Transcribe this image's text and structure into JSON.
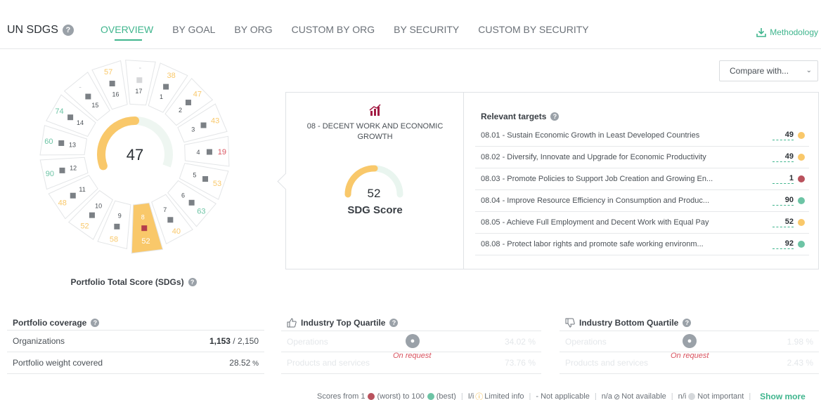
{
  "header": {
    "brand": "UN SDGS",
    "tabs": [
      "OVERVIEW",
      "BY GOAL",
      "BY ORG",
      "CUSTOM BY ORG",
      "BY SECURITY",
      "CUSTOM BY SECURITY"
    ],
    "active_tab": "OVERVIEW",
    "methodology": "Methodology"
  },
  "wheel": {
    "total_score": "47",
    "total_label": "Portfolio Total Score (SDGs)",
    "segments": [
      {
        "goal": "1",
        "score": "38"
      },
      {
        "goal": "2",
        "score": "47"
      },
      {
        "goal": "3",
        "score": "43"
      },
      {
        "goal": "4",
        "score": "19"
      },
      {
        "goal": "5",
        "score": "53"
      },
      {
        "goal": "6",
        "score": "63"
      },
      {
        "goal": "7",
        "score": "40"
      },
      {
        "goal": "8",
        "score": "52"
      },
      {
        "goal": "9",
        "score": "58"
      },
      {
        "goal": "10",
        "score": "52"
      },
      {
        "goal": "11",
        "score": "48"
      },
      {
        "goal": "12",
        "score": "90"
      },
      {
        "goal": "13",
        "score": "60"
      },
      {
        "goal": "14",
        "score": "74"
      },
      {
        "goal": "15",
        "score": "-"
      },
      {
        "goal": "16",
        "score": "57"
      },
      {
        "goal": "17",
        "score": "-"
      }
    ],
    "icon_labels": {
      "goal1": "MM"
    }
  },
  "compare": {
    "label": "Compare with..."
  },
  "goal_detail": {
    "title": "08 - DECENT WORK AND ECONOMIC GROWTH",
    "score": "52",
    "score_label": "SDG Score",
    "targets_heading": "Relevant targets",
    "targets": [
      {
        "label": "08.01 - Sustain Economic Growth in Least Developed Countries",
        "score": "49",
        "color": "#f9c86a"
      },
      {
        "label": "08.02 - Diversify, Innovate and Upgrade for Economic Productivity",
        "score": "49",
        "color": "#f9c86a"
      },
      {
        "label": "08.03 - Promote Policies to Support Job Creation and Growing En...",
        "score": "1",
        "color": "#b9525d"
      },
      {
        "label": "08.04 - Improve Resource Efficiency in Consumption and Produc...",
        "score": "90",
        "color": "#6dc4a5"
      },
      {
        "label": "08.05 - Achieve Full Employment and Decent Work with Equal Pay",
        "score": "52",
        "color": "#f9c86a"
      },
      {
        "label": "08.08 - Protect labor rights and promote safe working environm...",
        "score": "92",
        "color": "#6dc4a5"
      }
    ]
  },
  "coverage": {
    "title": "Portfolio coverage",
    "rows": [
      {
        "label": "Organizations",
        "value_bold": "1,153",
        "value_rest": " / 2,150"
      },
      {
        "label": "Portfolio weight covered",
        "value_bold": "28.52",
        "value_rest": " %"
      }
    ]
  },
  "top_quartile": {
    "title": "Industry Top Quartile",
    "rows": [
      {
        "label": "Operations",
        "value": "34.02 %"
      },
      {
        "label": "Products and services",
        "value": "73.76 %"
      }
    ],
    "locked_text": "On request"
  },
  "bottom_quartile": {
    "title": "Industry Bottom Quartile",
    "rows": [
      {
        "label": "Operations",
        "value": "1.98 %"
      },
      {
        "label": "Products and services",
        "value": "2.43 %"
      }
    ],
    "locked_text": "On request"
  },
  "legend": {
    "scores_prefix": "Scores from 1",
    "worst": "(worst) to 100",
    "best": "(best)",
    "limited": "I/i",
    "limited_label": "Limited info",
    "na": "- Not applicable",
    "not_available_code": "n/a",
    "not_available": "Not available",
    "not_important_code": "n/i",
    "not_important": "Not important",
    "show_more": "Show more",
    "colors": {
      "worst": "#b9525d",
      "best": "#6dc4a5",
      "mid": "#f9c86a",
      "limited": "#f2b53c"
    }
  }
}
